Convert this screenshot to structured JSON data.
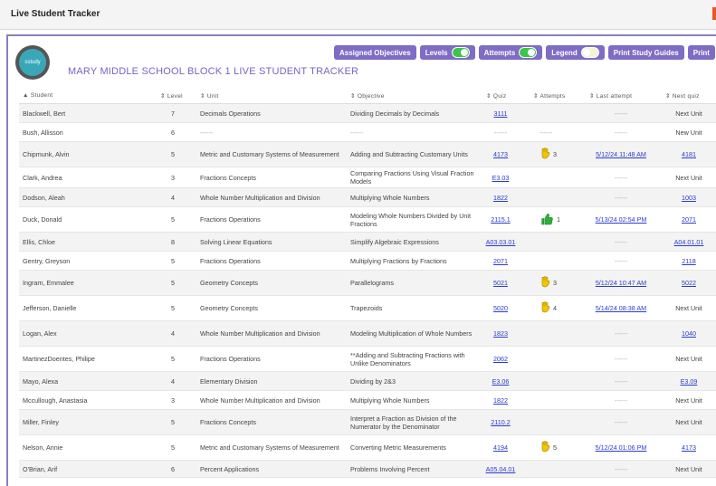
{
  "window": {
    "title": "Live Student Tracker"
  },
  "header": {
    "logo_text": "sstudy",
    "school_title": "MARY  MIDDLE SCHOOL BLOCK 1 LIVE STUDENT TRACKER"
  },
  "toolbar": {
    "assigned_objectives": "Assigned Objectives",
    "levels": "Levels",
    "attempts": "Attempts",
    "legend": "Legend",
    "print_study_guides": "Print Study Guides",
    "print": "Print"
  },
  "columns": {
    "student": "▲ Student",
    "level": "⇕ Level",
    "unit": "⇕ Unit",
    "objective": "⇕ Objective",
    "quiz": "⇕ Quiz",
    "attempts": "⇕ Attempts",
    "last_attempt": "⇕ Last attempt",
    "next_quiz": "⇕ Next quiz"
  },
  "rows": [
    {
      "name": "Blackwell, Bert",
      "level": "7",
      "unit": "Decimals Operations",
      "objective": "Dividing Decimals by Decimals",
      "quiz": "3111",
      "att_icon": "",
      "attempts": "",
      "last": "------",
      "next": "Next Unit",
      "next_link": false
    },
    {
      "name": "Bush, Allisson",
      "level": "6",
      "unit": "------",
      "objective": "------",
      "quiz": "------",
      "att_icon": "",
      "attempts": "------",
      "last": "------",
      "next": "New Unit",
      "next_link": false
    },
    {
      "name": "Chipmunk, Alvin",
      "level": "5",
      "unit": "Metric and Customary Systems of Measurement",
      "objective": "Adding and Subtracting Customary Units",
      "quiz": "4173",
      "att_icon": "hand-yellow",
      "attempts": "3",
      "last": "5/12/24 11:48 AM",
      "next": "4181",
      "next_link": true
    },
    {
      "name": "Clark, Andrea",
      "level": "3",
      "unit": "Fractions Concepts",
      "objective": "Comparing Fractions Using Visual Fraction Models",
      "quiz": "E3.03",
      "att_icon": "",
      "attempts": "",
      "last": "------",
      "next": "Next Unit",
      "next_link": false
    },
    {
      "name": "Dodson, Aleah",
      "level": "4",
      "unit": "Whole Number Multiplication and Division",
      "objective": "Multiplying Whole Numbers",
      "quiz": "1822",
      "att_icon": "",
      "attempts": "",
      "last": "------",
      "next": "1003",
      "next_link": true
    },
    {
      "name": "Duck, Donald",
      "level": "5",
      "unit": "Fractions Operations",
      "objective": "Modeling Whole Numbers Divided by Unit Fractions",
      "quiz": "2115.1",
      "att_icon": "thumb-green",
      "attempts": "1",
      "last": "5/13/24 02:54 PM",
      "next": "2071",
      "next_link": true
    },
    {
      "name": "Ellis, Chloe",
      "level": "8",
      "unit": "Solving Linear Equations",
      "objective": "Simplify Algebraic Expressions",
      "quiz": "A03.03.01",
      "att_icon": "",
      "attempts": "",
      "last": "------",
      "next": "A04.01.01",
      "next_link": true
    },
    {
      "name": "Gentry, Greyson",
      "level": "5",
      "unit": "Fractions Operations",
      "objective": "Multiplying Fractions by Fractions",
      "quiz": "2071",
      "att_icon": "",
      "attempts": "",
      "last": "------",
      "next": "2118",
      "next_link": true
    },
    {
      "name": "Ingram, Emmalee",
      "level": "5",
      "unit": "Geometry Concepts",
      "objective": "Parallelograms",
      "quiz": "5021",
      "att_icon": "hand-yellow",
      "attempts": "3",
      "last": "5/12/24 10:47 AM",
      "next": "5022",
      "next_link": true
    },
    {
      "name": "Jefferson, Danielle",
      "level": "5",
      "unit": "Geometry Concepts",
      "objective": "Trapezoids",
      "quiz": "5020",
      "att_icon": "hand-yellow",
      "attempts": "4",
      "last": "5/14/24 08:38 AM",
      "next": "Next Unit",
      "next_link": false
    },
    {
      "name": "Logan, Alex",
      "level": "4",
      "unit": "Whole Number Multiplication and Division",
      "objective": "Modeling Multiplication of Whole Numbers",
      "quiz": "1823",
      "att_icon": "",
      "attempts": "",
      "last": "------",
      "next": "1040",
      "next_link": true
    },
    {
      "name": "MartinezDoentes, Philipe",
      "level": "5",
      "unit": "Fractions Operations",
      "objective": "**Adding and Subtracting Fractions with Unlike Denominators",
      "quiz": "2062",
      "att_icon": "",
      "attempts": "",
      "last": "------",
      "next": "Next Unit",
      "next_link": false
    },
    {
      "name": "Mayo, Alexa",
      "level": "4",
      "unit": "Elementary Division",
      "objective": "Dividing by 2&3",
      "quiz": "E3.06",
      "att_icon": "",
      "attempts": "",
      "last": "------",
      "next": "E3.09",
      "next_link": true
    },
    {
      "name": "Mccullough, Anastasia",
      "level": "3",
      "unit": "Whole Number Multiplication and Division",
      "objective": "Multiplying Whole Numbers",
      "quiz": "1822",
      "att_icon": "",
      "attempts": "",
      "last": "------",
      "next": "Next Unit",
      "next_link": false
    },
    {
      "name": "Miller, Finley",
      "level": "5",
      "unit": "Fractions Concepts",
      "objective": "Interpret a Fraction as Division of the Numerator by the Denominator",
      "quiz": "2110.2",
      "att_icon": "",
      "attempts": "",
      "last": "------",
      "next": "Next Unit",
      "next_link": false
    },
    {
      "name": "Nelson, Annie",
      "level": "5",
      "unit": "Metric and Customary Systems of Measurement",
      "objective": "Converting Metric Measurements",
      "quiz": "4194",
      "att_icon": "hand-yellow",
      "attempts": "5",
      "last": "5/12/24 01:06 PM",
      "next": "4173",
      "next_link": true
    },
    {
      "name": "O'Brian, Arif",
      "level": "6",
      "unit": "Percent Applications",
      "objective": "Problems Involving Percent",
      "quiz": "A05.04.01",
      "att_icon": "",
      "attempts": "",
      "last": "------",
      "next": "Next Unit",
      "next_link": false
    }
  ],
  "colors": {
    "accent": "#7f6cc4",
    "link": "#2a3ccf",
    "toggle_on": "#3cc54a",
    "hand": "#f2c500",
    "thumb": "#2eae3a"
  }
}
